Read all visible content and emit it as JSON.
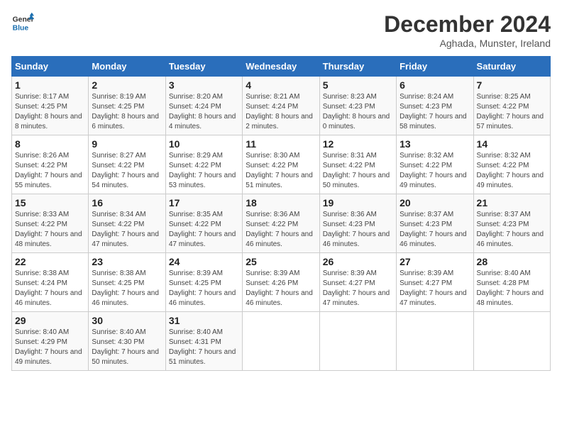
{
  "header": {
    "logo_line1": "General",
    "logo_line2": "Blue",
    "month": "December 2024",
    "location": "Aghada, Munster, Ireland"
  },
  "days_of_week": [
    "Sunday",
    "Monday",
    "Tuesday",
    "Wednesday",
    "Thursday",
    "Friday",
    "Saturday"
  ],
  "weeks": [
    [
      {
        "day": "1",
        "sunrise": "8:17 AM",
        "sunset": "4:25 PM",
        "daylight": "8 hours and 8 minutes."
      },
      {
        "day": "2",
        "sunrise": "8:19 AM",
        "sunset": "4:25 PM",
        "daylight": "8 hours and 6 minutes."
      },
      {
        "day": "3",
        "sunrise": "8:20 AM",
        "sunset": "4:24 PM",
        "daylight": "8 hours and 4 minutes."
      },
      {
        "day": "4",
        "sunrise": "8:21 AM",
        "sunset": "4:24 PM",
        "daylight": "8 hours and 2 minutes."
      },
      {
        "day": "5",
        "sunrise": "8:23 AM",
        "sunset": "4:23 PM",
        "daylight": "8 hours and 0 minutes."
      },
      {
        "day": "6",
        "sunrise": "8:24 AM",
        "sunset": "4:23 PM",
        "daylight": "7 hours and 58 minutes."
      },
      {
        "day": "7",
        "sunrise": "8:25 AM",
        "sunset": "4:22 PM",
        "daylight": "7 hours and 57 minutes."
      }
    ],
    [
      {
        "day": "8",
        "sunrise": "8:26 AM",
        "sunset": "4:22 PM",
        "daylight": "7 hours and 55 minutes."
      },
      {
        "day": "9",
        "sunrise": "8:27 AM",
        "sunset": "4:22 PM",
        "daylight": "7 hours and 54 minutes."
      },
      {
        "day": "10",
        "sunrise": "8:29 AM",
        "sunset": "4:22 PM",
        "daylight": "7 hours and 53 minutes."
      },
      {
        "day": "11",
        "sunrise": "8:30 AM",
        "sunset": "4:22 PM",
        "daylight": "7 hours and 51 minutes."
      },
      {
        "day": "12",
        "sunrise": "8:31 AM",
        "sunset": "4:22 PM",
        "daylight": "7 hours and 50 minutes."
      },
      {
        "day": "13",
        "sunrise": "8:32 AM",
        "sunset": "4:22 PM",
        "daylight": "7 hours and 49 minutes."
      },
      {
        "day": "14",
        "sunrise": "8:32 AM",
        "sunset": "4:22 PM",
        "daylight": "7 hours and 49 minutes."
      }
    ],
    [
      {
        "day": "15",
        "sunrise": "8:33 AM",
        "sunset": "4:22 PM",
        "daylight": "7 hours and 48 minutes."
      },
      {
        "day": "16",
        "sunrise": "8:34 AM",
        "sunset": "4:22 PM",
        "daylight": "7 hours and 47 minutes."
      },
      {
        "day": "17",
        "sunrise": "8:35 AM",
        "sunset": "4:22 PM",
        "daylight": "7 hours and 47 minutes."
      },
      {
        "day": "18",
        "sunrise": "8:36 AM",
        "sunset": "4:22 PM",
        "daylight": "7 hours and 46 minutes."
      },
      {
        "day": "19",
        "sunrise": "8:36 AM",
        "sunset": "4:23 PM",
        "daylight": "7 hours and 46 minutes."
      },
      {
        "day": "20",
        "sunrise": "8:37 AM",
        "sunset": "4:23 PM",
        "daylight": "7 hours and 46 minutes."
      },
      {
        "day": "21",
        "sunrise": "8:37 AM",
        "sunset": "4:23 PM",
        "daylight": "7 hours and 46 minutes."
      }
    ],
    [
      {
        "day": "22",
        "sunrise": "8:38 AM",
        "sunset": "4:24 PM",
        "daylight": "7 hours and 46 minutes."
      },
      {
        "day": "23",
        "sunrise": "8:38 AM",
        "sunset": "4:25 PM",
        "daylight": "7 hours and 46 minutes."
      },
      {
        "day": "24",
        "sunrise": "8:39 AM",
        "sunset": "4:25 PM",
        "daylight": "7 hours and 46 minutes."
      },
      {
        "day": "25",
        "sunrise": "8:39 AM",
        "sunset": "4:26 PM",
        "daylight": "7 hours and 46 minutes."
      },
      {
        "day": "26",
        "sunrise": "8:39 AM",
        "sunset": "4:27 PM",
        "daylight": "7 hours and 47 minutes."
      },
      {
        "day": "27",
        "sunrise": "8:39 AM",
        "sunset": "4:27 PM",
        "daylight": "7 hours and 47 minutes."
      },
      {
        "day": "28",
        "sunrise": "8:40 AM",
        "sunset": "4:28 PM",
        "daylight": "7 hours and 48 minutes."
      }
    ],
    [
      {
        "day": "29",
        "sunrise": "8:40 AM",
        "sunset": "4:29 PM",
        "daylight": "7 hours and 49 minutes."
      },
      {
        "day": "30",
        "sunrise": "8:40 AM",
        "sunset": "4:30 PM",
        "daylight": "7 hours and 50 minutes."
      },
      {
        "day": "31",
        "sunrise": "8:40 AM",
        "sunset": "4:31 PM",
        "daylight": "7 hours and 51 minutes."
      },
      null,
      null,
      null,
      null
    ]
  ]
}
